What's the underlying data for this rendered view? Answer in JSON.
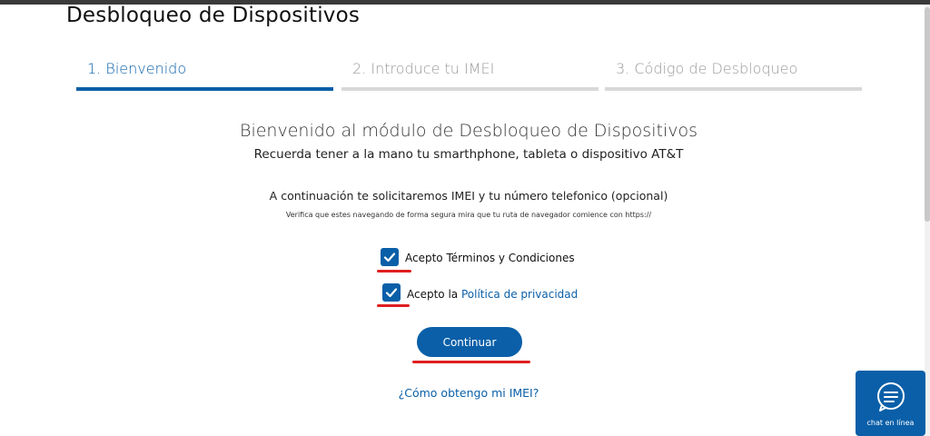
{
  "page": {
    "title": "Desbloqueo de Dispositivos"
  },
  "steps": [
    {
      "label": "1. Bienvenido",
      "active": true
    },
    {
      "label": "2. Introduce tu IMEI",
      "active": false
    },
    {
      "label": "3. Código de Desbloqueo",
      "active": false
    }
  ],
  "welcome": {
    "heading": "Bienvenido al módulo de Desbloqueo de Dispositivos",
    "subtitle": "Recuerda tener a la mano tu smarthphone, tableta o dispositivo AT&T",
    "info": "A continuación te solicitaremos IMEI y tu número telefonico (opcional)",
    "info_small": "Verifica que estes navegando de forma segura mira que tu ruta de navegador comience con https://"
  },
  "consent": {
    "terms_label": "Acepto Términos y Condiciones",
    "terms_checked": true,
    "privacy_prefix": "Acepto la ",
    "privacy_link": "Política de privacidad",
    "privacy_checked": true
  },
  "actions": {
    "continue_label": "Continuar",
    "imei_help_link": "¿Cómo obtengo mi IMEI?"
  },
  "chat": {
    "label": "chat en línea",
    "icon": "chat-bubble-icon"
  },
  "colors": {
    "accent": "#0a5fa8",
    "inactive_step": "#d8d8d8",
    "annotation": "#e01e1e"
  }
}
